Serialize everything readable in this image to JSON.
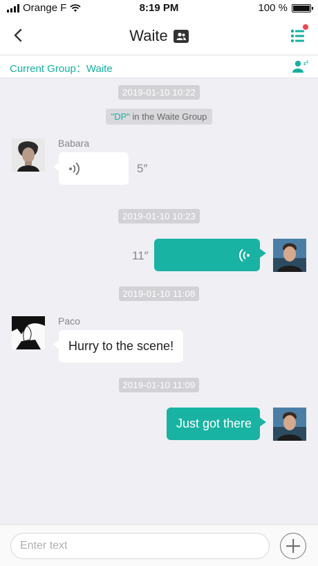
{
  "status_bar": {
    "carrier": "Orange F",
    "time": "8:19 PM",
    "battery": "100 %"
  },
  "header": {
    "title": "Waite",
    "back_icon": "chevron-left-icon",
    "menu_icon": "list-menu-icon",
    "accent_color": "#13b1a0",
    "notification_dot_color": "#f0444c"
  },
  "group_bar": {
    "label": "Current Group：Waite",
    "icon": "user-sleep-icon"
  },
  "notice": {
    "highlight": "\"DP\"",
    "rest": " in the Waite Group"
  },
  "messages": [
    {
      "timestamp": "2019-01-10  10:22"
    },
    {
      "sender": "Babara",
      "type": "voice",
      "direction": "incoming",
      "duration": "5″"
    },
    {
      "timestamp": "2019-01-10  10:23"
    },
    {
      "type": "voice",
      "direction": "outgoing",
      "duration": "11″"
    },
    {
      "timestamp": "2019-01-10  11:08"
    },
    {
      "sender": "Paco",
      "type": "text",
      "direction": "incoming",
      "text": "Hurry to the scene!"
    },
    {
      "timestamp": "2019-01-10  11:09"
    },
    {
      "type": "text",
      "direction": "outgoing",
      "text": "Just got there"
    }
  ],
  "input": {
    "placeholder": "Enter text",
    "value": ""
  }
}
